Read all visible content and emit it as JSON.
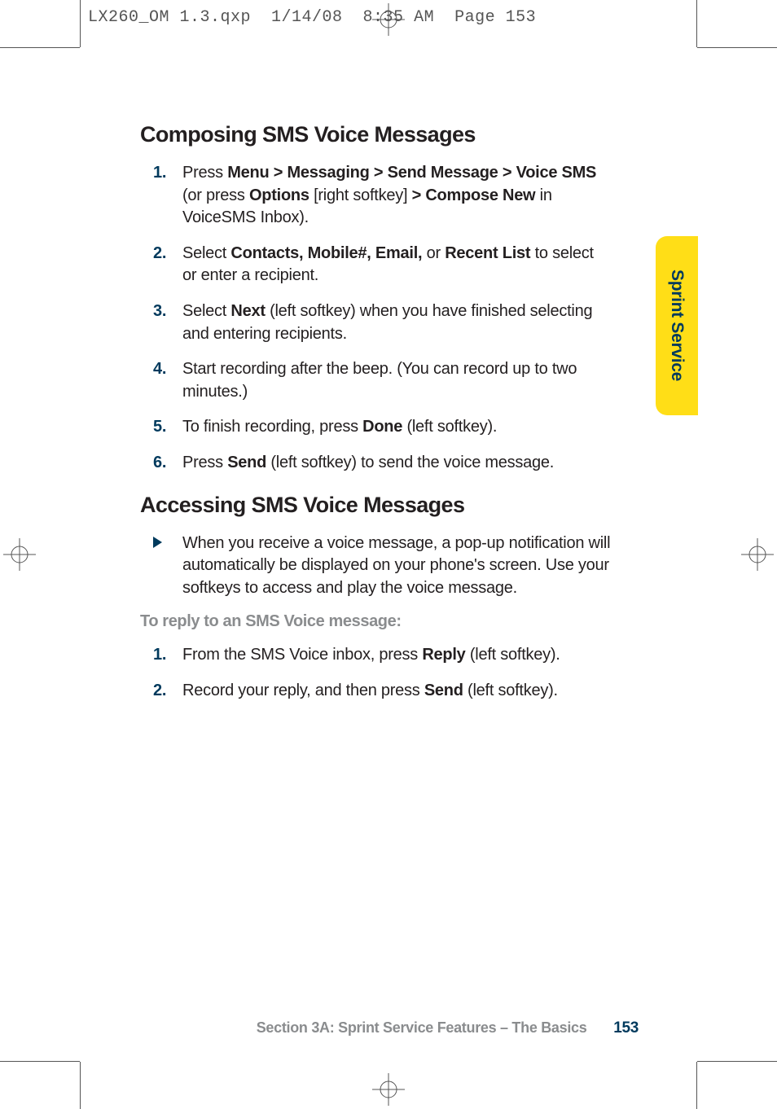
{
  "slug": "LX260_OM 1.3.qxp  1/14/08  8:35 AM  Page 153",
  "tab": "Sprint Service",
  "section1": {
    "title": "Composing SMS Voice Messages",
    "steps": [
      "Press <b>Menu > Messaging > Send Message > Voice SMS</b> (or press <b>Options</b> [right softkey] <b>> Compose New</b> in VoiceSMS Inbox).",
      "Select <b>Contacts, Mobile#, Email,</b> or <b>Recent List</b> to select or enter a recipient.",
      "Select <b>Next</b> (left softkey) when you have finished selecting and entering recipients.",
      "Start recording after the beep. (You can record up to two minutes.)",
      "To finish recording, press <b>Done</b> (left softkey).",
      "Press <b>Send</b> (left softkey) to send the voice message."
    ]
  },
  "section2": {
    "title": "Accessing SMS Voice Messages",
    "bullets": [
      "When you receive a voice message, a pop-up notification will automatically be displayed on your phone's screen. Use your softkeys to access and play the voice message."
    ],
    "subhead": "To reply to an SMS Voice message:",
    "steps": [
      "From the SMS Voice inbox, press <b>Reply</b> (left softkey).",
      "Record your reply, and then press <b>Send</b> (left softkey)."
    ]
  },
  "footer": {
    "text": "Section 3A: Sprint Service Features – The Basics",
    "page": "153"
  }
}
